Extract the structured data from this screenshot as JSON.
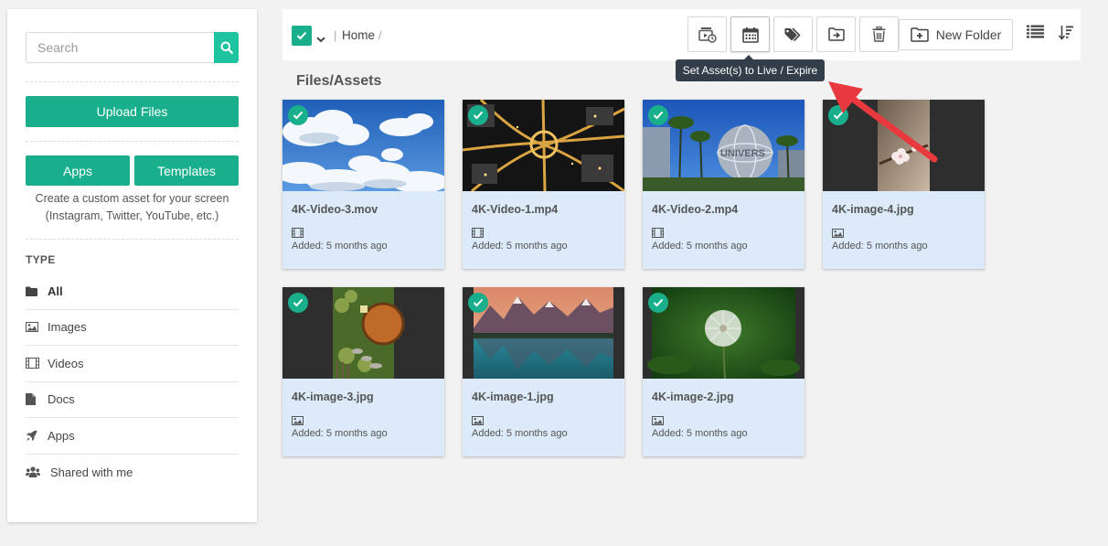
{
  "sidebar": {
    "search_placeholder": "Search",
    "upload_label": "Upload Files",
    "apps_label": "Apps",
    "templates_label": "Templates",
    "description": "Create a custom asset for your screen (Instagram, Twitter, YouTube, etc.)",
    "type_heading": "TYPE",
    "types": [
      {
        "label": "All",
        "icon": "folder-icon"
      },
      {
        "label": "Images",
        "icon": "image-icon"
      },
      {
        "label": "Videos",
        "icon": "film-icon"
      },
      {
        "label": "Docs",
        "icon": "document-icon"
      },
      {
        "label": "Apps",
        "icon": "rocket-icon"
      },
      {
        "label": "Shared with me",
        "icon": "users-icon"
      }
    ]
  },
  "toolbar": {
    "breadcrumb_home": "Home",
    "new_folder_label": "New Folder",
    "tooltip": "Set Asset(s) to Live / Expire",
    "buttons": [
      "schedule-playlist-icon",
      "calendar-icon",
      "tags-icon",
      "move-to-folder-icon",
      "trash-icon",
      "list-view-icon",
      "sort-icon"
    ]
  },
  "section_title": "Files/Assets",
  "assets": [
    {
      "name": "4K-Video-3.mov",
      "type": "video",
      "added": "Added: 5 months ago",
      "selected": true
    },
    {
      "name": "4K-Video-1.mp4",
      "type": "video",
      "added": "Added: 5 months ago",
      "selected": true
    },
    {
      "name": "4K-Video-2.mp4",
      "type": "video",
      "added": "Added: 5 months ago",
      "selected": true
    },
    {
      "name": "4K-image-4.jpg",
      "type": "image",
      "added": "Added: 5 months ago",
      "selected": true
    },
    {
      "name": "4K-image-3.jpg",
      "type": "image",
      "added": "Added: 5 months ago",
      "selected": true
    },
    {
      "name": "4K-image-1.jpg",
      "type": "image",
      "added": "Added: 5 months ago",
      "selected": true
    },
    {
      "name": "4K-image-2.jpg",
      "type": "image",
      "added": "Added: 5 months ago",
      "selected": true
    }
  ],
  "colors": {
    "accent": "#1aaf8c",
    "card_bg": "#dceaf9",
    "tooltip_bg": "#343e4b",
    "arrow": "#e8393f"
  }
}
